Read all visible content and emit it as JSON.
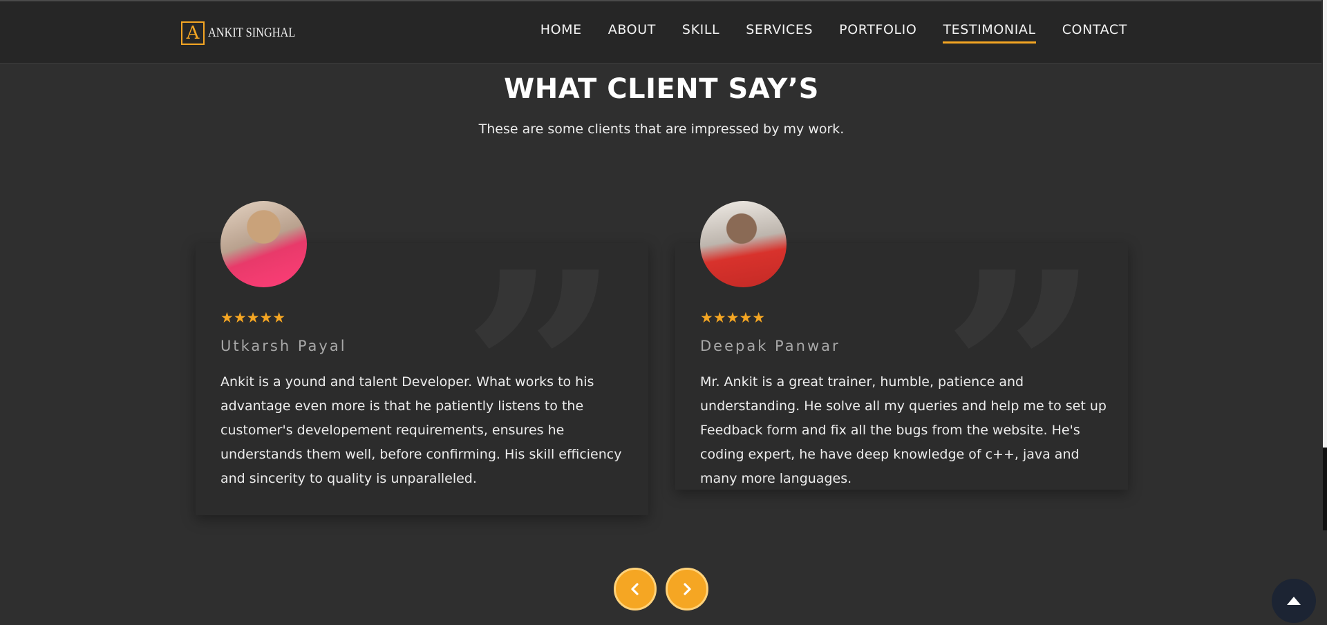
{
  "header": {
    "logo_letter": "A",
    "logo_text": "ANKIT SINGHAL",
    "nav": [
      {
        "label": "HOME"
      },
      {
        "label": "ABOUT"
      },
      {
        "label": "SKILL"
      },
      {
        "label": "SERVICES"
      },
      {
        "label": "PORTFOLIO"
      },
      {
        "label": "TESTIMONIAL"
      },
      {
        "label": "CONTACT"
      }
    ],
    "active_nav": "TESTIMONIAL"
  },
  "section": {
    "title": "WHAT CLIENT SAY’S",
    "subtitle": "These are some clients that are impressed by my work."
  },
  "testimonials": [
    {
      "name": "Utkarsh Payal",
      "rating": 5,
      "stars": "★★★★★",
      "text": "Ankit is a yound and talent Developer. What works to his advantage even more is that he patiently listens to the customer's developement requirements, ensures he understands them well, before confirming. His skill efficiency and sincerity to quality is unparalleled."
    },
    {
      "name": "Deepak Panwar",
      "rating": 5,
      "stars": "★★★★★",
      "text": "Mr. Ankit is a great trainer, humble, patience and understanding. He solve all my queries and help me to set up Feedback form and fix all the bugs from the website. He's coding expert, he have deep knowledge of c++, java and many more languages."
    }
  ],
  "controls": {
    "prev_icon": "chevron-left-icon",
    "next_icon": "chevron-right-icon",
    "back_to_top_icon": "caret-up-icon"
  },
  "colors": {
    "accent": "#f5a623",
    "background": "#2f2f2f",
    "nav_background": "#262626",
    "card_background": "#2c2c2c"
  }
}
